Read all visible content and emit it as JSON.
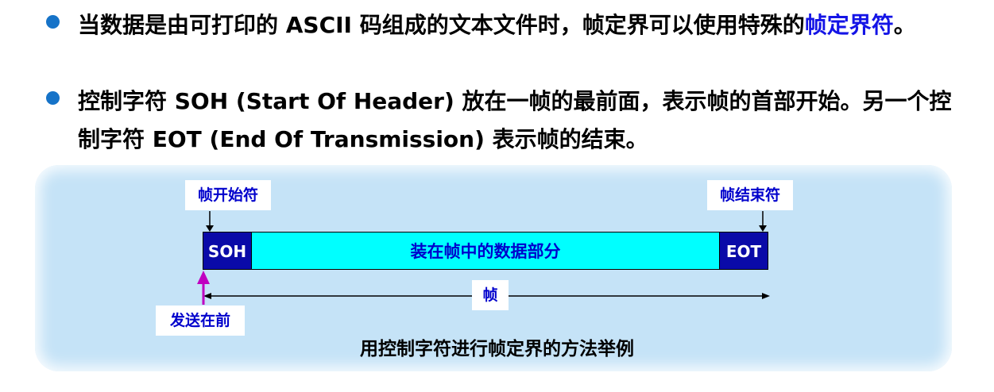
{
  "bullets": [
    {
      "text_before": "当数据是由可打印的 ASCII 码组成的文本文件时，帧定界可以使用特殊的",
      "highlight": "帧定界符",
      "text_after": "。"
    },
    {
      "text": "控制字符 SOH (Start Of Header) 放在一帧的最前面，表示帧的首部开始。另一个控制字符 EOT (End Of Transmission) 表示帧的结束。"
    }
  ],
  "diagram": {
    "start_label": "帧开始符",
    "end_label": "帧结束符",
    "soh": "SOH",
    "data": "装在帧中的数据部分",
    "eot": "EOT",
    "frame_label": "帧",
    "send_label": "发送在前",
    "caption": "用控制字符进行帧定界的方法举例"
  },
  "colors": {
    "bullet": "#1673c8",
    "highlight": "#1414e6",
    "panel": "#c5e3f7",
    "dark_segment": "#0a0aa8",
    "data_segment": "#00ffff",
    "label_text": "#0000cc",
    "send_arrow": "#c000c0"
  }
}
